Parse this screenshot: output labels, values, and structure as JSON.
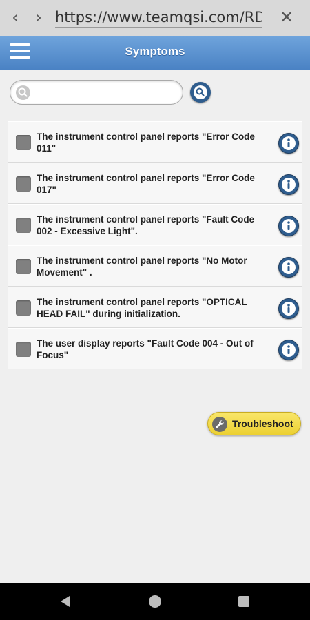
{
  "browser": {
    "back_glyph": "‹",
    "forward_glyph": "›",
    "url": "https://www.teamqsi.com/RDS/",
    "close_glyph": "✕"
  },
  "header": {
    "title": "Symptoms",
    "menu_icon": "hamburger-menu-icon"
  },
  "search": {
    "value": "",
    "placeholder": "",
    "icon": "search-icon"
  },
  "symptoms": [
    {
      "text": "The instrument control panel reports \"Error Code 011\"",
      "checked": false
    },
    {
      "text": "The instrument control panel reports \"Error Code 017\"",
      "checked": false
    },
    {
      "text": "The instrument control panel reports \"Fault Code 002 - Excessive Light\".",
      "checked": false
    },
    {
      "text": "The instrument control panel reports \"No Motor Movement\" .",
      "checked": false
    },
    {
      "text": "The instrument control panel reports \"OPTICAL HEAD FAIL\" during initialization.",
      "checked": false
    },
    {
      "text": "The user display reports \"Fault Code 004 - Out of Focus\"",
      "checked": false
    }
  ],
  "troubleshoot": {
    "label": "Troubleshoot",
    "icon": "wrench-icon"
  },
  "colors": {
    "header_blue": "#4a82c4",
    "button_navy": "#2f5d8e",
    "troubleshoot_yellow": "#ecd032"
  }
}
